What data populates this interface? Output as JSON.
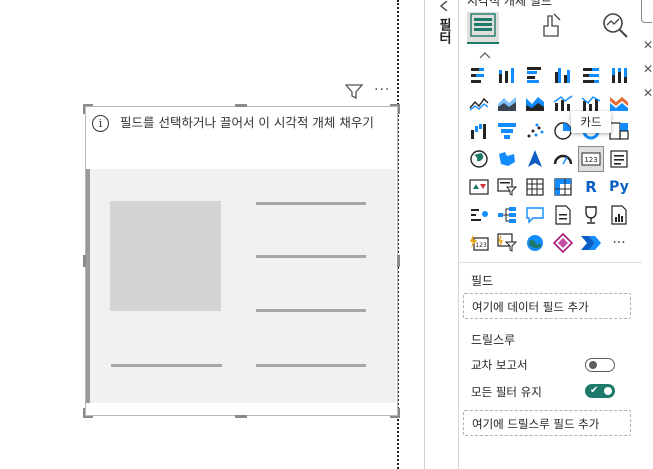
{
  "canvas": {
    "message": "필드를 선택하거나 끌어서 이 시각적 개체 채우기",
    "info_icon": "i"
  },
  "visual_header": {
    "filter_icon": "filter-icon",
    "more_icon": "more-options-icon"
  },
  "side_tab": {
    "label": "필터"
  },
  "pane": {
    "title": "시각적 개체 빌드",
    "tooltip": "카드",
    "fields_section": "필드",
    "fields_placeholder": "여기에 데이터 필드 추가",
    "drillthrough_section": "드릴스루",
    "cross_report_label": "교차 보고서",
    "cross_report_on": false,
    "keep_filters_label": "모든 필터 유지",
    "keep_filters_on": true,
    "drillthrough_placeholder": "여기에 드릴스루 필드 추가",
    "more_visuals": "···",
    "r_label": "R",
    "py_label": "Py"
  },
  "colors": {
    "accent": "#118dff",
    "teal": "#1d7a6a",
    "orange": "#e66c37"
  }
}
